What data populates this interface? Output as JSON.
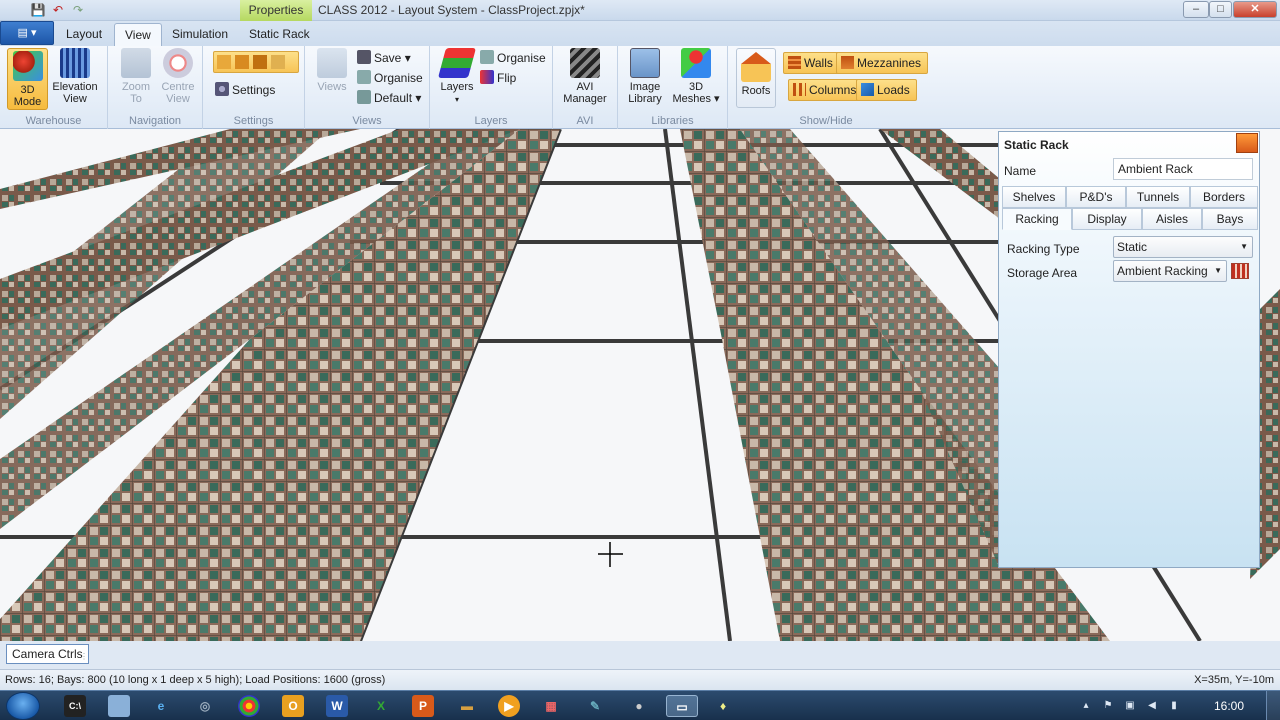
{
  "window": {
    "title": "CLASS 2012 - Layout System - ClassProject.zpjx*",
    "context_tab": "Properties",
    "minimize": "–",
    "maximize": "□",
    "close": "✕"
  },
  "ribbon_tabs": [
    {
      "label": "Layout"
    },
    {
      "label": "View"
    },
    {
      "label": "Simulation"
    },
    {
      "label": "Static Rack"
    }
  ],
  "groups": {
    "warehouse": {
      "label": "Warehouse",
      "mode_3d": "3D\nMode",
      "elevation": "Elevation\nView"
    },
    "navigation": {
      "label": "Navigation",
      "zoom_to": "Zoom\nTo",
      "centre_view": "Centre\nView"
    },
    "settings": {
      "label": "Settings",
      "settings_btn": "Settings"
    },
    "views": {
      "label": "Views",
      "views_btn": "Views",
      "save": "Save",
      "organise": "Organise",
      "default": "Default"
    },
    "layers": {
      "label": "Layers",
      "layers_btn": "Layers",
      "organise": "Organise",
      "flip": "Flip"
    },
    "avi": {
      "label": "AVI",
      "manager": "AVI\nManager"
    },
    "libraries": {
      "label": "Libraries",
      "image_library": "Image\nLibrary",
      "meshes": "3D\nMeshes"
    },
    "show_hide": {
      "label": "Show/Hide",
      "roofs": "Roofs",
      "walls": "Walls",
      "mezzanines": "Mezzanines",
      "columns": "Columns",
      "loads": "Loads"
    }
  },
  "properties": {
    "title": "Static Rack",
    "name_label": "Name",
    "name_value": "Ambient Rack",
    "tabs_row1": [
      "Shelves",
      "P&D's",
      "Tunnels",
      "Borders"
    ],
    "tabs_row2": [
      "Racking",
      "Display",
      "Aisles",
      "Bays"
    ],
    "racking_type_label": "Racking Type",
    "racking_type_value": "Static",
    "storage_area_label": "Storage Area",
    "storage_area_value": "Ambient Racking"
  },
  "camera_ctrls": "Camera Ctrls",
  "status": {
    "left": "Rows: 16; Bays: 800 (10 long x 1 deep x 5 high); Load Positions: 1600 (gross)",
    "right": "X=35m, Y=-10m"
  },
  "taskbar": {
    "clock": "16:00"
  },
  "colors": {
    "accent_orange": "#f7c456",
    "ribbon_blue": "#dde8f5",
    "context_green": "#b5d860",
    "rack_brown": "#7a5a4a"
  }
}
